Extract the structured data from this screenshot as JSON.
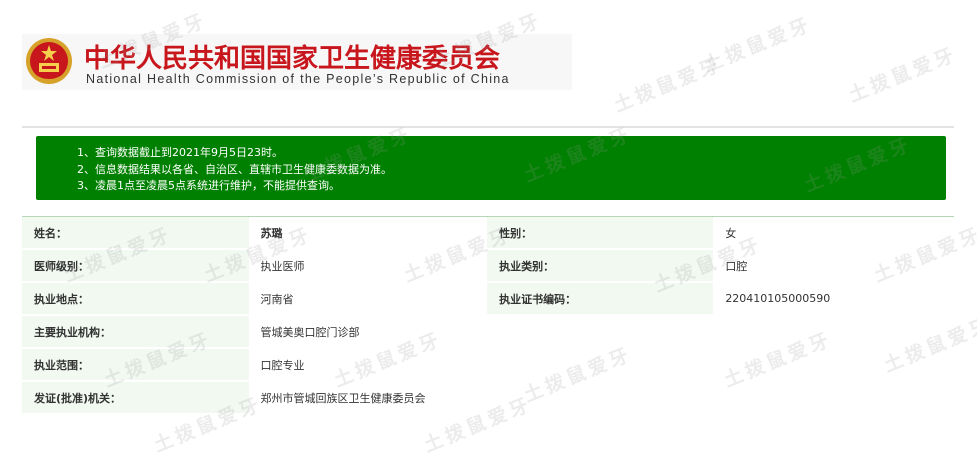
{
  "header": {
    "title_cn": "中华人民共和国国家卫生健康委员会",
    "title_en": "National Health Commission of the People’s Republic of China"
  },
  "notice": {
    "lines": [
      "1、查询数据截止到2021年9月5日23时。",
      "2、信息数据结果以各省、自治区、直辖市卫生健康委数据为准。",
      "3、凌晨1点至凌晨5点系统进行维护，不能提供查询。"
    ]
  },
  "info": {
    "name_label": "姓名：",
    "name_value": "苏璐",
    "gender_label": "性别：",
    "gender_value": "女",
    "level_label": "医师级别：",
    "level_value": "执业医师",
    "category_label": "执业类别：",
    "category_value": "口腔",
    "location_label": "执业地点：",
    "location_value": "河南省",
    "cert_label": "执业证书编码：",
    "cert_value": "220410105000590",
    "institution_label": "主要执业机构：",
    "institution_value": "管城美奥口腔门诊部",
    "scope_label": "执业范围：",
    "scope_value": "口腔专业",
    "issuer_label": "发证(批准)机关：",
    "issuer_value": "郑州市管城回族区卫生健康委员会"
  },
  "watermark": {
    "text": "土拨鼠爱牙"
  },
  "colors": {
    "brand_red": "#c8161d",
    "notice_green": "#008000",
    "label_bg": "#f1f9f1"
  }
}
